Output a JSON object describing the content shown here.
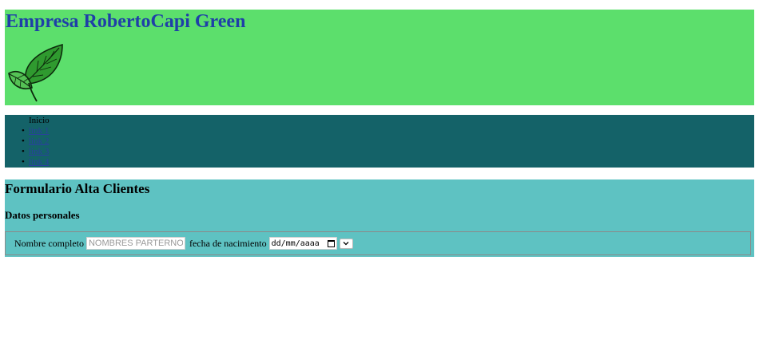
{
  "header": {
    "title": "Empresa RobertoCapi Green",
    "logo_icon": "leaf-icon",
    "background": "#5cdf6c",
    "title_color": "#1f3fa8"
  },
  "nav": {
    "background": "#146268",
    "items": [
      {
        "label": "Inicio"
      },
      {
        "label": "link 1"
      },
      {
        "label": "link 2"
      },
      {
        "label": "link 3"
      },
      {
        "label": "link 4"
      }
    ]
  },
  "form": {
    "background": "#5ec2c2",
    "title": "Formulario Alta Clientes",
    "subtitle": "Datos personales",
    "name_label": "Nombre completo",
    "name_placeholder": "NOMBRES PARTERNOS",
    "name_value": "",
    "birth_label": "fecha de nacimiento",
    "birth_value": "dd/mm/aaaa",
    "calendar_icon": "calendar-icon",
    "select_icon": "chevron-down-icon",
    "select_value": ""
  }
}
